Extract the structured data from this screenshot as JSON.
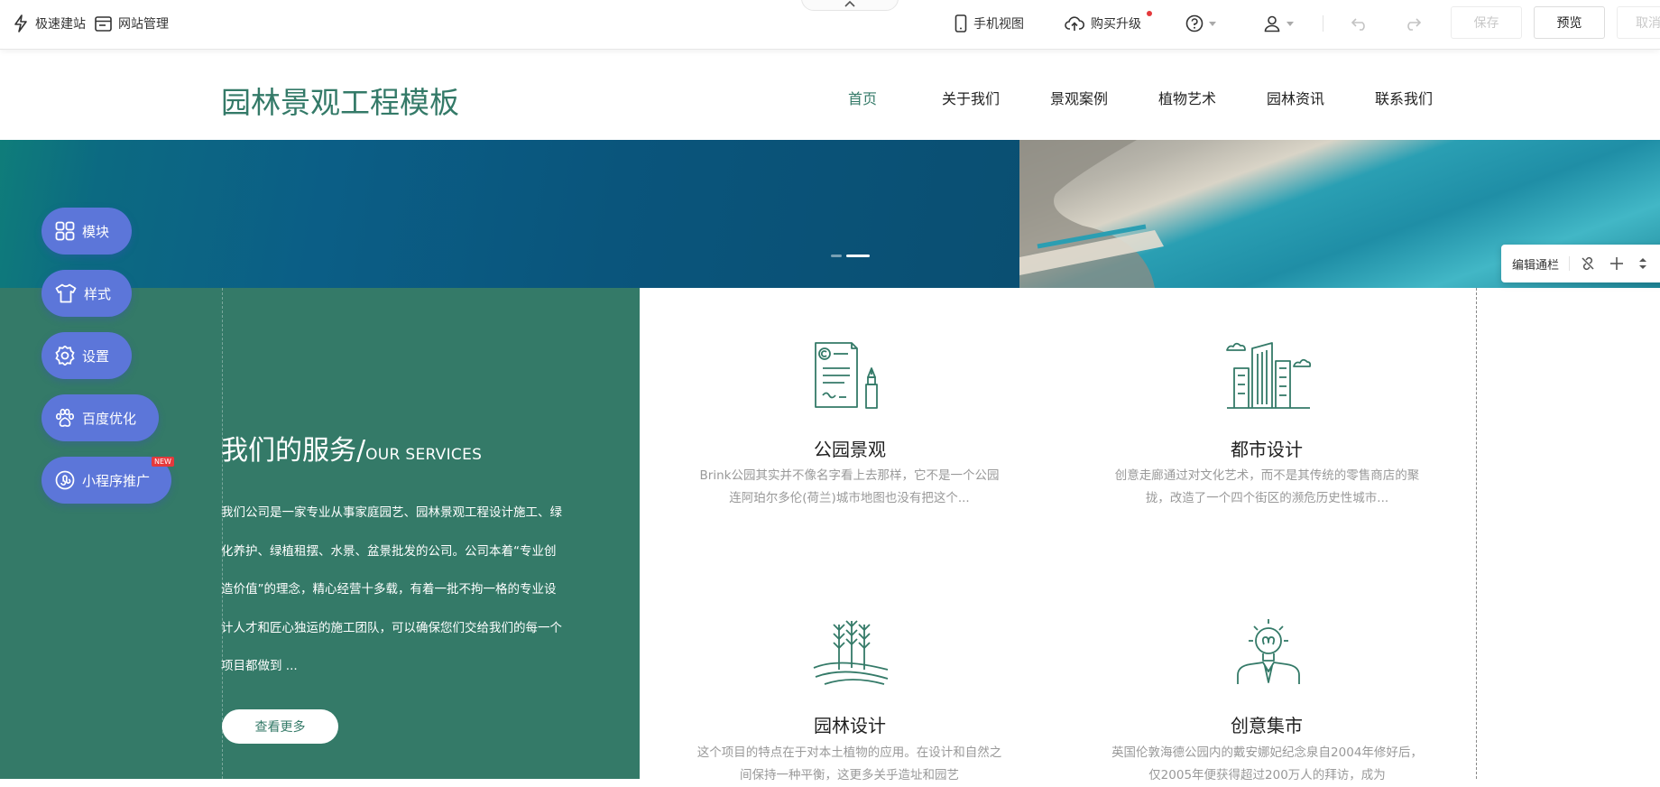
{
  "toolbar": {
    "quick_build": "极速建站",
    "site_manage": "网站管理",
    "mobile_view": "手机视图",
    "upgrade": "购买升级",
    "save": "保存",
    "preview": "预览",
    "cancel": "取消"
  },
  "site": {
    "logo": "园林景观工程模板",
    "nav": [
      "首页",
      "关于我们",
      "景观案例",
      "植物艺术",
      "园林资讯",
      "联系我们"
    ]
  },
  "services": {
    "title_cn": "我们的服务/",
    "title_en": "OUR SERVICES",
    "description": "我们公司是一家专业从事家庭园艺、园林景观工程设计施工、绿化养护、绿植租摆、水景、盆景批发的公司。公司本着“专业创造价值”的理念，精心经营十多载，有着一批不拘一格的专业设计人才和匠心独运的施工团队，可以确保您们交给我们的每一个项目都做到 ...",
    "more_button": "查看更多",
    "cards": [
      {
        "title": "公园景观",
        "desc": "Brink公园其实并不像名字看上去那样，它不是一个公园连阿珀尔多伦(荷兰)城市地图也没有把这个..."
      },
      {
        "title": "都市设计",
        "desc": "创意走廊通过对文化艺术，而不是其传统的零售商店的聚拢，改造了一个四个街区的濒危历史性城市..."
      },
      {
        "title": "园林设计",
        "desc": "这个项目的特点在于对本土植物的应用。在设计和自然之间保持一种平衡，这更多关乎造址和园艺"
      },
      {
        "title": "创意集市",
        "desc": "英国伦敦海德公园内的戴安娜妃纪念泉自2004年修好后，仅2005年便获得超过200万人的拜访，成为"
      }
    ]
  },
  "side_menu": {
    "items": [
      "模块",
      "样式",
      "设置",
      "百度优化",
      "小程序推广"
    ],
    "new_badge": "NEW"
  },
  "edit_bar": {
    "label": "编辑通栏"
  },
  "colors": {
    "brand_green": "#347a68",
    "side_menu": "#5c76d9",
    "badge_red": "#e4393c"
  }
}
